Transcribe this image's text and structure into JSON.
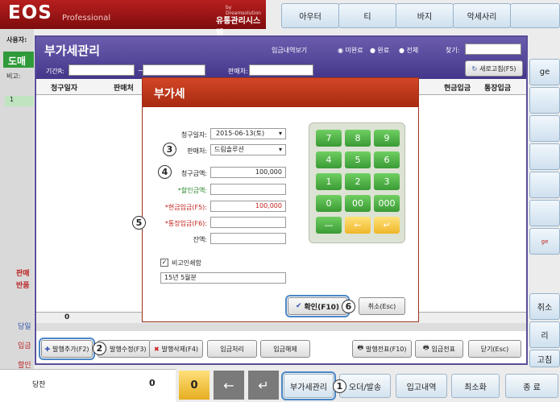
{
  "app": {
    "logo": "EOS",
    "logo_sub": "Professional",
    "vendor": "by Dreamsolution",
    "system": "유통관리시스템"
  },
  "top_buttons": [
    "아우터",
    "티",
    "바지",
    "악세사리"
  ],
  "side_right": [
    "ge",
    "",
    "",
    "",
    "",
    "",
    "ge",
    "취소",
    "리",
    "",
    "고침"
  ],
  "left": {
    "user_label": "사용자:",
    "user_value": "도매",
    "memo_label": "비고:",
    "row_num": "1",
    "bottom1": "판매",
    "bottom2": "반품",
    "bal_label": "당잔",
    "bal_value": "0",
    "lbl_a": "당일",
    "lbl_b": "입금",
    "lbl_c": "할인금"
  },
  "bottom_bar": {
    "zero": "0",
    "vat": "부가세관리",
    "order": "오더/발송",
    "receipt": "입고내역",
    "minimize": "최소화",
    "exit": "종 료"
  },
  "vat_manager": {
    "title": "부가세관리",
    "view_label": "입금내역보기",
    "opt_unpaid": "미완료",
    "opt_done": "완료",
    "opt_all": "전체",
    "search_label": "찾기:",
    "refresh": "새로고침(F5)",
    "period_label": "기간R:",
    "dash": "~",
    "seller_label": "판매처:",
    "columns": [
      "청구일자",
      "판매처",
      "",
      "",
      "현금입금",
      "통장입금"
    ],
    "total": "0",
    "buttons": {
      "add": "발행추가(F2)",
      "edit": "발행수정(F3)",
      "delete": "발행삭제(F4)",
      "process": "입금처리",
      "cancel_dep": "입금해제",
      "print": "발행전표(F10)",
      "slip": "입금전표",
      "close": "닫기(Esc)"
    }
  },
  "dialog": {
    "title": "부가세",
    "date_label": "청구일자:",
    "date_value": "2015-06-13(토)",
    "seller_label": "판매처:",
    "seller_value": "드림솔루션",
    "amount_label": "청구금액:",
    "amount_value": "100,000",
    "discount_label": "*할인금액:",
    "discount_value": "",
    "cash_label": "*현금입금(F5):",
    "cash_value": "100,000",
    "bank_label": "*통장입금(F6):",
    "bank_value": "",
    "balance_label": "잔액:",
    "balance_value": "",
    "note_check": "비고인쇄함",
    "note_value": "15년 5월분",
    "ok": "확인(F10)",
    "cancel": "취소(Esc)",
    "keys": [
      "7",
      "8",
      "9",
      "4",
      "5",
      "6",
      "1",
      "2",
      "3",
      "0",
      "00",
      "000",
      "—",
      "←",
      "↵"
    ]
  },
  "markers": [
    "1",
    "2",
    "3",
    "4",
    "5",
    "6"
  ],
  "colors": {
    "brand": "#9e1616",
    "window": "#4f4396",
    "dialog": "#c2391d",
    "key_green": "#4fae45",
    "key_yellow": "#f5c43a",
    "highlight": "#4b87c7"
  }
}
